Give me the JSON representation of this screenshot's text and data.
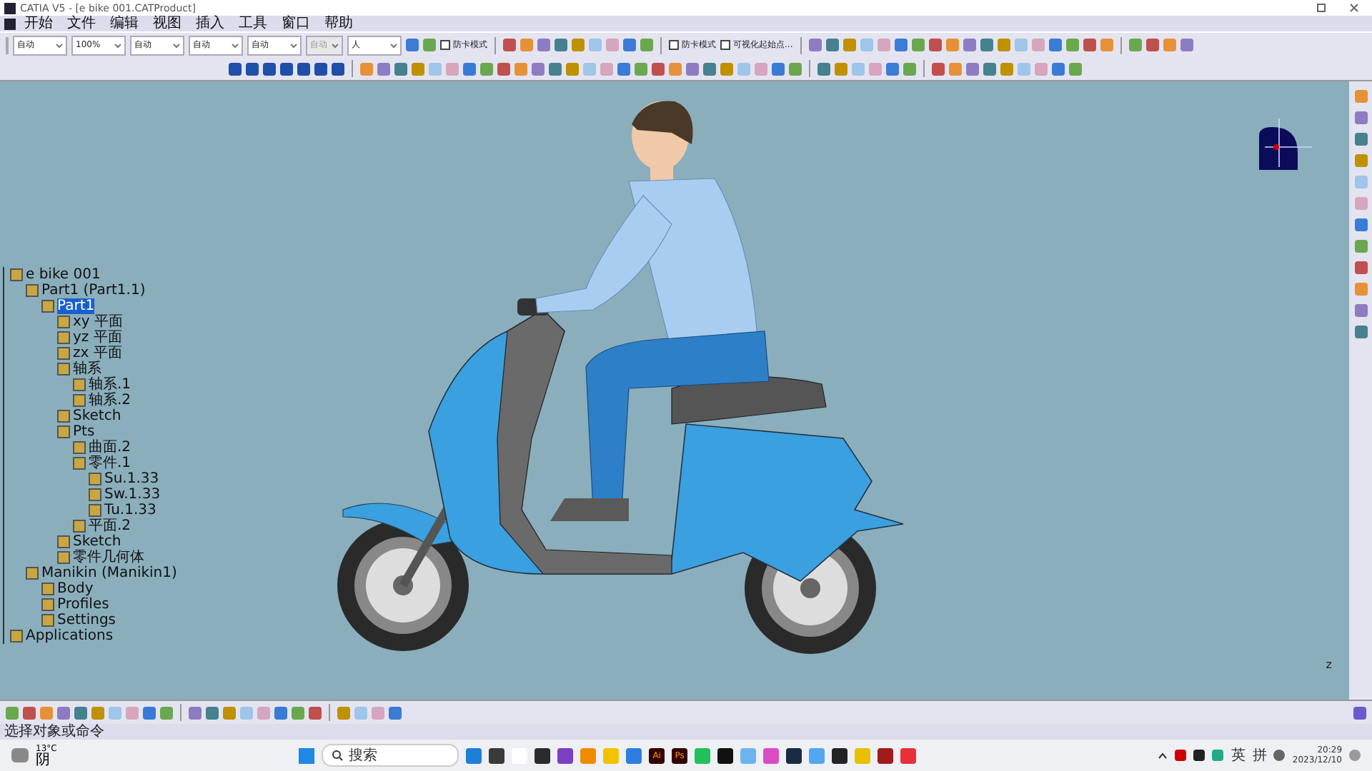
{
  "window": {
    "title": "CATIA V5 - [e bike 001.CATProduct]"
  },
  "menu": [
    "开始",
    "文件",
    "编辑",
    "视图",
    "插入",
    "工具",
    "窗口",
    "帮助"
  ],
  "toolbar": {
    "dropdowns": [
      {
        "value": "自动",
        "disabled": false
      },
      {
        "value": "100%",
        "disabled": false
      },
      {
        "value": "自动",
        "disabled": false
      },
      {
        "value": "自动",
        "disabled": false
      },
      {
        "value": "自动",
        "disabled": false
      },
      {
        "value": "自动",
        "disabled": true
      },
      {
        "value": "人",
        "disabled": false
      }
    ],
    "checkboxes": [
      {
        "label": "防卡模式",
        "checked": false
      },
      {
        "label": "防卡模式",
        "checked": false
      },
      {
        "label": "可视化起始点...",
        "checked": false
      }
    ]
  },
  "tree": {
    "items": [
      {
        "label": "e bike 001",
        "selected": false,
        "children": [
          {
            "label": "Part1 (Part1.1)",
            "selected": false,
            "children": [
              {
                "label": "Part1",
                "selected": true,
                "children": [
                  {
                    "label": "xy 平面",
                    "selected": false
                  },
                  {
                    "label": "yz 平面",
                    "selected": false
                  },
                  {
                    "label": "zx 平面",
                    "selected": false
                  },
                  {
                    "label": "轴系",
                    "selected": false,
                    "children": [
                      {
                        "label": "轴系.1",
                        "selected": false
                      },
                      {
                        "label": "轴系.2",
                        "selected": false
                      }
                    ]
                  },
                  {
                    "label": "Sketch",
                    "selected": false
                  },
                  {
                    "label": "Pts",
                    "selected": false,
                    "children": [
                      {
                        "label": "曲面.2",
                        "selected": false
                      },
                      {
                        "label": "零件.1",
                        "selected": false,
                        "children": [
                          {
                            "label": "Su.1.33",
                            "selected": false
                          },
                          {
                            "label": "Sw.1.33",
                            "selected": false
                          },
                          {
                            "label": "Tu.1.33",
                            "selected": false
                          }
                        ]
                      },
                      {
                        "label": "平面.2",
                        "selected": false
                      }
                    ]
                  },
                  {
                    "label": "Sketch",
                    "selected": false
                  },
                  {
                    "label": "零件几何体",
                    "selected": false
                  }
                ]
              }
            ]
          },
          {
            "label": "Manikin (Manikin1)",
            "selected": false,
            "children": [
              {
                "label": "Body",
                "selected": false
              },
              {
                "label": "Profiles",
                "selected": false
              },
              {
                "label": "Settings",
                "selected": false
              }
            ]
          }
        ]
      },
      {
        "label": "Applications",
        "selected": false
      }
    ]
  },
  "viewport": {
    "axis_label": "z"
  },
  "status_bar": {
    "message": "选择对象或命令"
  },
  "taskbar": {
    "weather": {
      "temp": "13°C",
      "condition": "阴"
    },
    "search": {
      "placeholder": "搜索"
    },
    "apps": [
      {
        "kind": "icon"
      },
      {
        "kind": "icon"
      },
      {
        "kind": "icon"
      },
      {
        "kind": "icon"
      },
      {
        "kind": "icon"
      },
      {
        "kind": "icon"
      },
      {
        "kind": "icon"
      },
      {
        "kind": "icon"
      },
      {
        "kind": "text",
        "label": "Ai"
      },
      {
        "kind": "text",
        "label": "Ps"
      },
      {
        "kind": "icon"
      },
      {
        "kind": "icon"
      },
      {
        "kind": "icon"
      },
      {
        "kind": "icon"
      },
      {
        "kind": "icon"
      },
      {
        "kind": "icon"
      },
      {
        "kind": "icon"
      },
      {
        "kind": "icon"
      },
      {
        "kind": "icon"
      },
      {
        "kind": "icon"
      }
    ],
    "tray": {
      "ime_lang": "英",
      "ime_mode": "拼",
      "time": "20:29",
      "date": "2023/12/10"
    }
  }
}
